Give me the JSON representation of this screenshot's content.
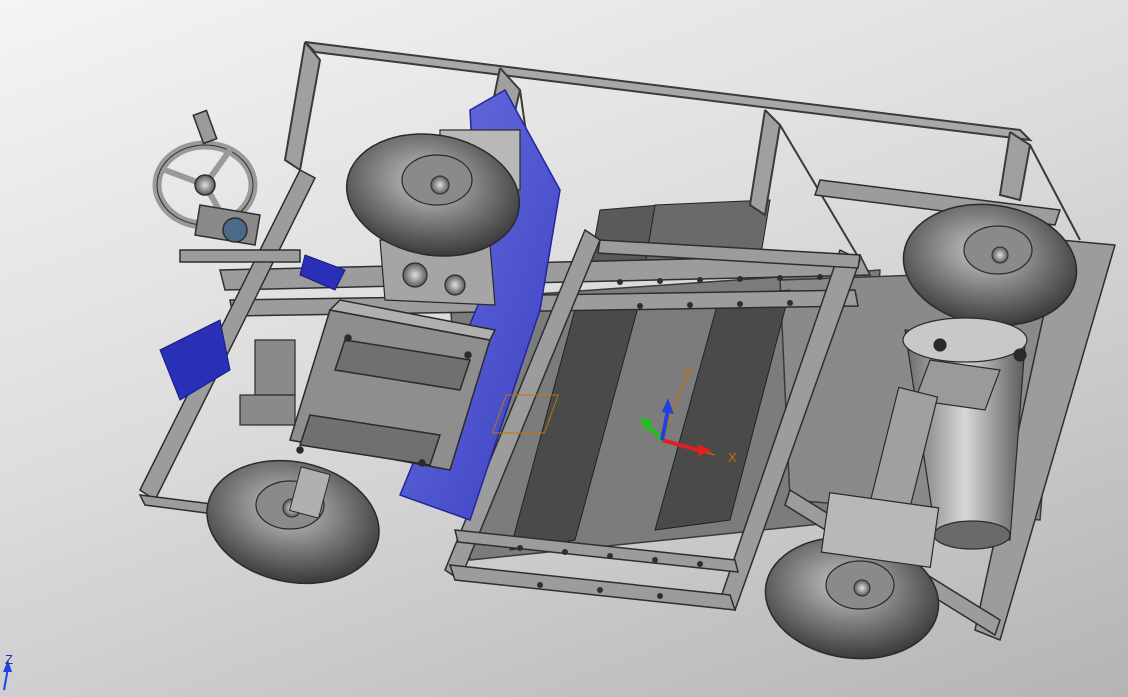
{
  "viewport": {
    "background_top": "#f2f2f2",
    "background_bottom": "#b8b8b8"
  },
  "triad": {
    "z_label": "Z",
    "x_label": "X",
    "y_label": "Y"
  },
  "colors": {
    "frame_fill": "#9a9a9a",
    "frame_edge": "#3a3a3a",
    "panel_dark": "#5a5a5a",
    "tire": "#6e6e6e",
    "tire_highlight": "#bdbdbd",
    "blue_plate": "#5a5fd0",
    "blue_plate_dark": "#2a2fb8",
    "axis_x": "#e02020",
    "axis_y": "#20c020",
    "axis_z": "#2040e0",
    "axis_label": "#c07800",
    "corner_axis_label": "#1a3aa0"
  }
}
